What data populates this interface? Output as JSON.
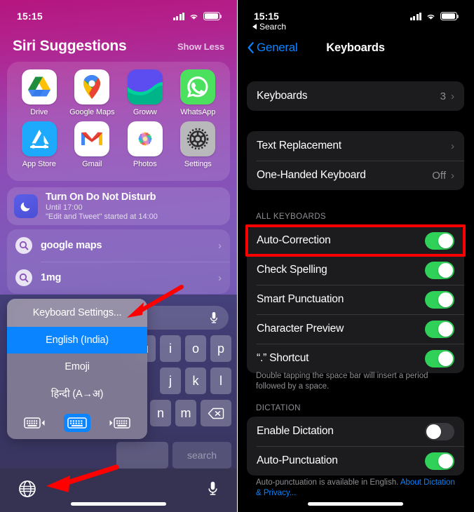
{
  "left": {
    "status": {
      "time": "15:15",
      "signal_icon": "cellular-signal-icon",
      "wifi_icon": "wifi-icon",
      "battery_icon": "battery-icon"
    },
    "siri": {
      "title": "Siri Suggestions",
      "show_less": "Show Less"
    },
    "apps": [
      {
        "name": "Drive",
        "icon": "google-drive-icon"
      },
      {
        "name": "Google Maps",
        "icon": "google-maps-icon"
      },
      {
        "name": "Groww",
        "icon": "groww-icon"
      },
      {
        "name": "WhatsApp",
        "icon": "whatsapp-icon"
      },
      {
        "name": "App Store",
        "icon": "app-store-icon"
      },
      {
        "name": "Gmail",
        "icon": "gmail-icon"
      },
      {
        "name": "Photos",
        "icon": "photos-icon"
      },
      {
        "name": "Settings",
        "icon": "settings-gear-icon"
      }
    ],
    "dnd": {
      "icon": "moon-icon",
      "title": "Turn On Do Not Disturb",
      "subtitle": "Until 17:00",
      "detail": "\"Edit and Tweet\" started at 14:00"
    },
    "suggestions": [
      {
        "icon": "search-icon",
        "label": "google maps",
        "chevron": "›"
      },
      {
        "icon": "search-icon",
        "label": "1mg",
        "chevron": "›"
      }
    ],
    "keyboard": {
      "mic_icon": "microphone-icon",
      "row1": [
        "u",
        "i",
        "o",
        "p"
      ],
      "row2": [
        "j",
        "k",
        "l"
      ],
      "row3": [
        "n",
        "m"
      ],
      "backspace_icon": "backspace-icon",
      "search_key": "search",
      "globe_icon": "globe-icon",
      "dictate_icon": "microphone-icon"
    },
    "popup": {
      "settings_item": "Keyboard Settings...",
      "items": [
        {
          "label": "English (India)",
          "active": true
        },
        {
          "label": "Emoji",
          "active": false
        },
        {
          "label": "हिन्दी (A→अ)",
          "active": false
        }
      ],
      "layout_icons": [
        {
          "name": "keyboard-left-icon",
          "selected": false
        },
        {
          "name": "keyboard-center-icon",
          "selected": true
        },
        {
          "name": "keyboard-right-icon",
          "selected": false
        }
      ]
    },
    "accent_blue": "#0a84ff",
    "arrow_color": "#ff0000"
  },
  "right": {
    "status": {
      "time": "15:15",
      "back_label": "Search"
    },
    "nav": {
      "back": "General",
      "title": "Keyboards"
    },
    "group1": [
      {
        "label": "Keyboards",
        "value": "3",
        "type": "link",
        "chevron": "›"
      }
    ],
    "group2": [
      {
        "label": "Text Replacement",
        "value": "",
        "type": "link",
        "chevron": "›"
      },
      {
        "label": "One-Handed Keyboard",
        "value": "Off",
        "type": "link",
        "chevron": "›"
      }
    ],
    "section_all_keyboards": "ALL KEYBOARDS",
    "group3": [
      {
        "label": "Auto-Correction",
        "toggle": "on",
        "highlighted": true
      },
      {
        "label": "Check Spelling",
        "toggle": "on",
        "highlighted": false
      },
      {
        "label": "Smart Punctuation",
        "toggle": "on",
        "highlighted": false
      },
      {
        "label": "Character Preview",
        "toggle": "on",
        "highlighted": false
      },
      {
        "label": "“.” Shortcut",
        "toggle": "on",
        "highlighted": false
      }
    ],
    "footer1": "Double tapping the space bar will insert a period followed by a space.",
    "section_dictation": "DICTATION",
    "group4": [
      {
        "label": "Enable Dictation",
        "toggle": "off"
      },
      {
        "label": "Auto-Punctuation",
        "toggle": "on"
      }
    ],
    "footer2_text": "Auto-punctuation is available in English. ",
    "footer2_link": "About Dictation & Privacy...",
    "toggle_on_color": "#30d158",
    "toggle_off_color": "#39393d",
    "accent_blue": "#0a84ff"
  }
}
